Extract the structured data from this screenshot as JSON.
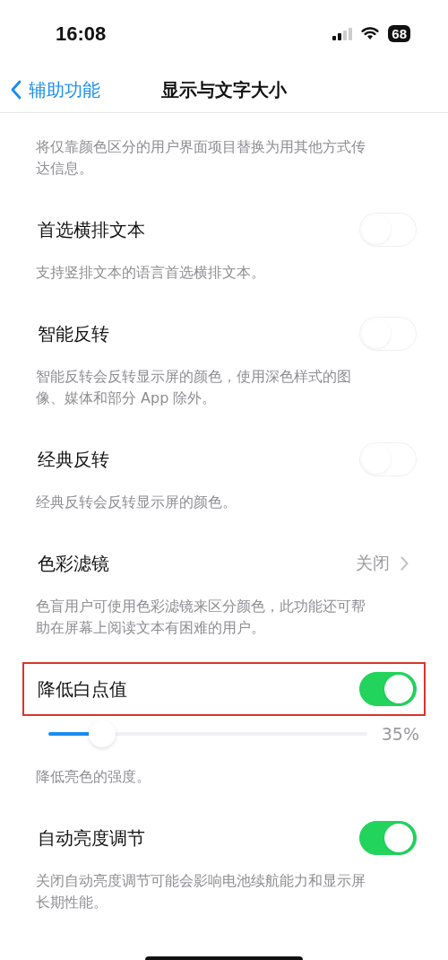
{
  "status_bar": {
    "time": "16:08",
    "battery": "68"
  },
  "nav": {
    "back": "辅助功能",
    "title": "显示与文字大小"
  },
  "items": [
    {
      "kind": "note",
      "description": "将仅靠颜色区分的用户界面项目替换为用其他方式传达信息。"
    },
    {
      "kind": "toggle",
      "title": "首选横排文本",
      "on": false,
      "description": "支持竖排文本的语言首选横排文本。"
    },
    {
      "kind": "toggle",
      "title": "智能反转",
      "on": false,
      "description": "智能反转会反转显示屏的颜色，使用深色样式的图像、媒体和部分 App 除外。"
    },
    {
      "kind": "toggle",
      "title": "经典反转",
      "on": false,
      "description": "经典反转会反转显示屏的颜色。"
    },
    {
      "kind": "link",
      "title": "色彩滤镜",
      "value": "关闭",
      "description": "色盲用户可使用色彩滤镜来区分颜色，此功能还可帮助在屏幕上阅读文本有困难的用户。"
    },
    {
      "kind": "toggle",
      "title": "降低白点值",
      "on": true,
      "highlighted": true,
      "slider": {
        "level": 0.17,
        "reading": "35%"
      },
      "description": "降低亮色的强度。"
    },
    {
      "kind": "toggle",
      "title": "自动亮度调节",
      "on": true,
      "description": "关闭自动亮度调节可能会影响电池续航能力和显示屏长期性能。"
    }
  ]
}
